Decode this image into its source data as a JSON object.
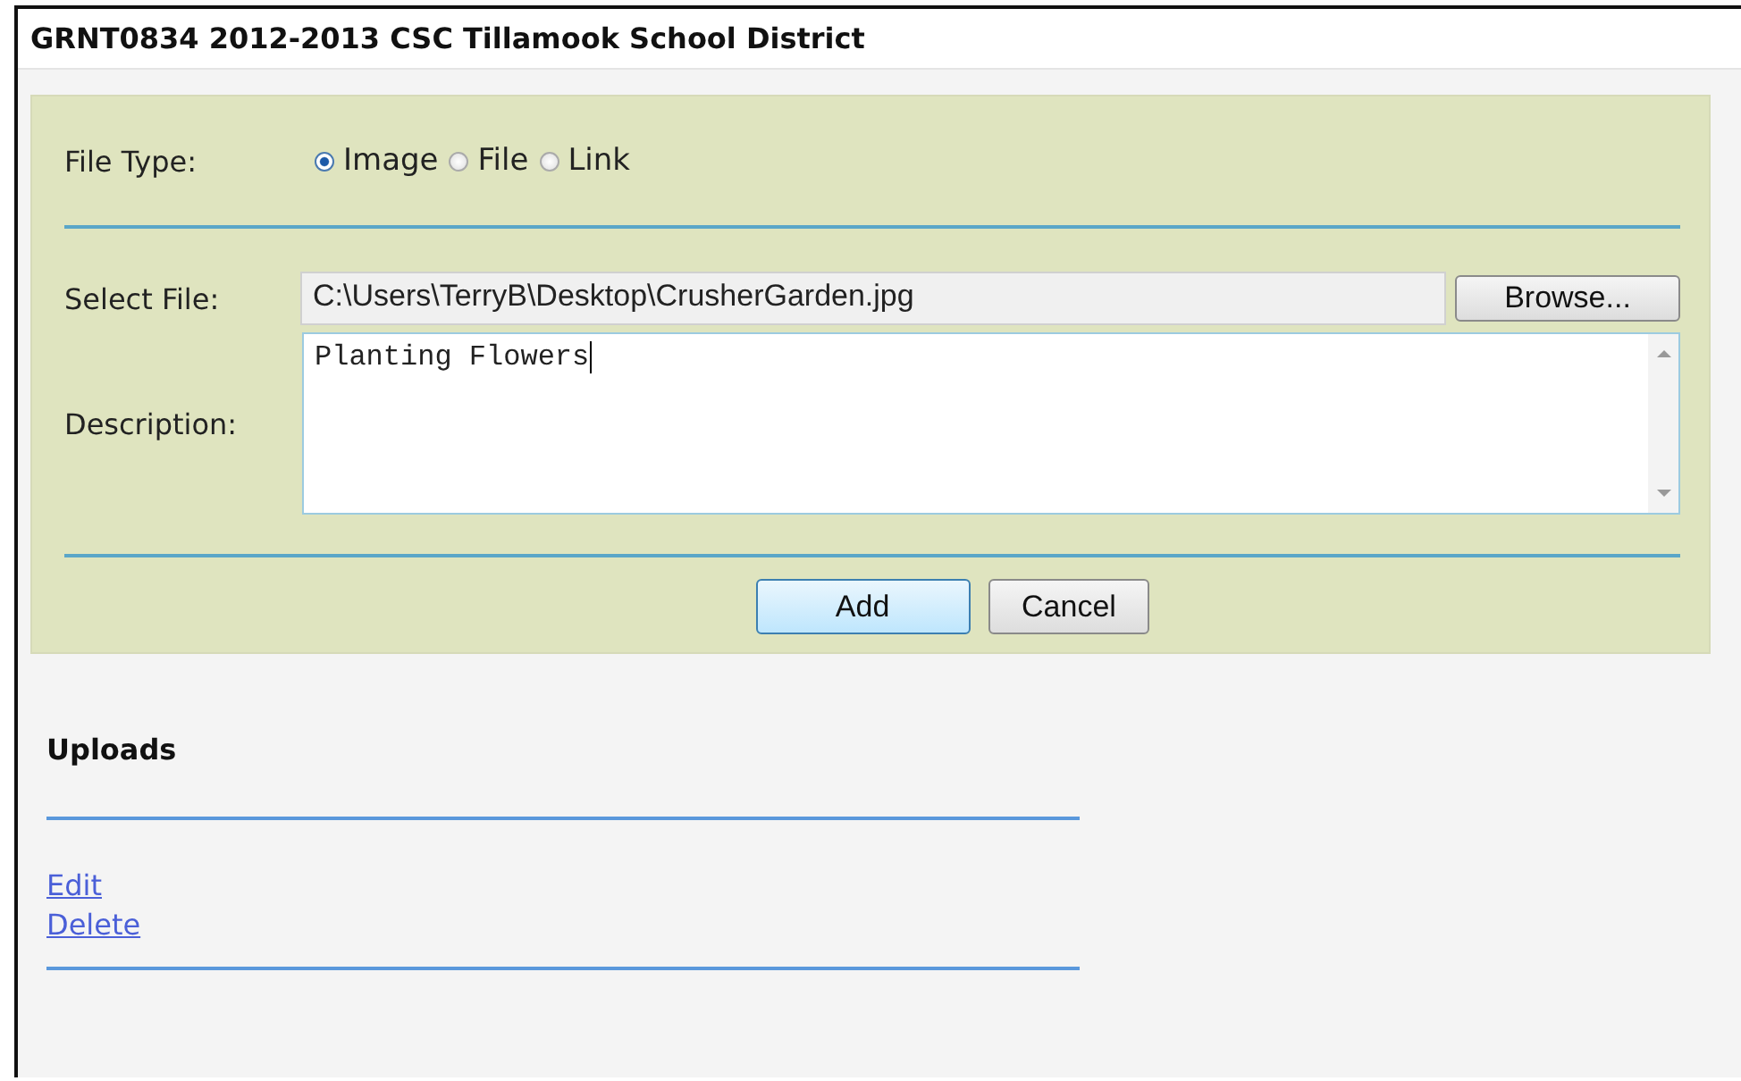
{
  "title": "GRNT0834 2012-2013 CSC Tillamook School District",
  "file_type": {
    "label": "File Type:",
    "options": [
      {
        "label": "Image",
        "selected": true
      },
      {
        "label": "File",
        "selected": false
      },
      {
        "label": "Link",
        "selected": false
      }
    ]
  },
  "select_file": {
    "label": "Select File:",
    "value": "C:\\Users\\TerryB\\Desktop\\CrusherGarden.jpg",
    "button": "Browse..."
  },
  "description": {
    "label": "Description:",
    "value": "Planting Flowers"
  },
  "buttons": [
    {
      "label": "Add",
      "kind": "primary"
    },
    {
      "label": "Cancel",
      "kind": "secondary"
    }
  ],
  "uploads": {
    "heading": "Uploads",
    "links": [
      "Edit",
      "Delete"
    ]
  }
}
